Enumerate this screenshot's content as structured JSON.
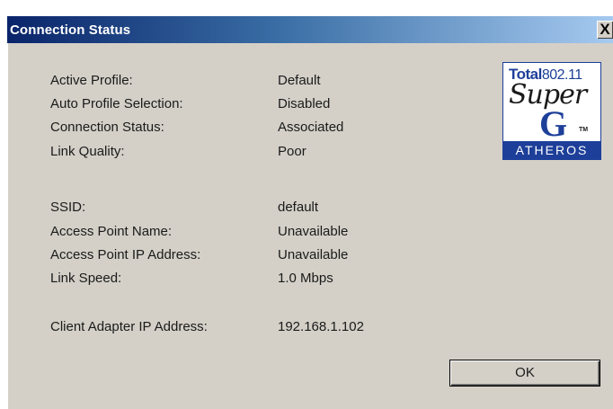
{
  "window": {
    "title": "Connection Status",
    "close_label": "X"
  },
  "fields": [
    {
      "label": "Active Profile:",
      "value": "Default"
    },
    {
      "label": "Auto Profile Selection:",
      "value": "Disabled"
    },
    {
      "label": "Connection Status:",
      "value": "Associated"
    },
    {
      "label": "Link Quality:",
      "value": "Poor"
    },
    {
      "label": "SSID:",
      "value": "default"
    },
    {
      "label": "Access Point Name:",
      "value": "Unavailable"
    },
    {
      "label": "Access Point IP Address:",
      "value": "Unavailable"
    },
    {
      "label": "Link Speed:",
      "value": "1.0 Mbps"
    },
    {
      "label": "Client Adapter IP Address:",
      "value": "192.168.1.102"
    }
  ],
  "logo": {
    "brand_word": "Total",
    "brand_num": "802.11",
    "super_text": "Super",
    "g_text": "G",
    "tm_text": "TM",
    "maker_text": "ATHEROS"
  },
  "buttons": {
    "ok_label": "OK"
  },
  "colors": {
    "title_start": "#0a246a",
    "title_end": "#a6caf0",
    "dialog_bg": "#d4d0c8",
    "logo_blue": "#1d3f99"
  }
}
